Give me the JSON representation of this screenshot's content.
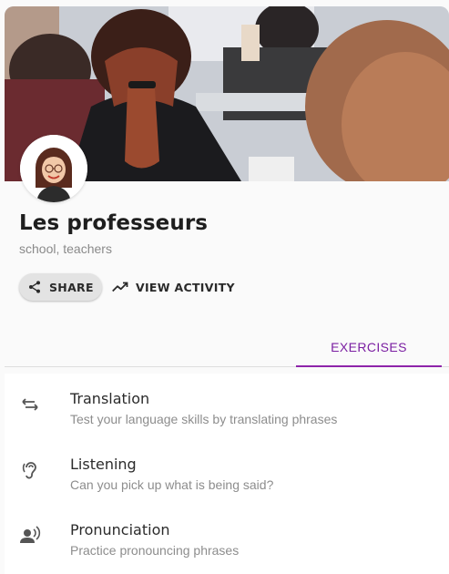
{
  "group": {
    "title": "Les professeurs",
    "tags": "school, teachers"
  },
  "actions": {
    "share_label": "SHARE",
    "activity_label": "VIEW ACTIVITY"
  },
  "tabs": [
    {
      "label": "EXERCISES",
      "active": true
    }
  ],
  "exercises": [
    {
      "name": "Translation",
      "description": "Test your language skills by translating phrases",
      "icon": "swap-arrows-icon"
    },
    {
      "name": "Listening",
      "description": "Can you pick up what is being said?",
      "icon": "hearing-ear-icon"
    },
    {
      "name": "Pronunciation",
      "description": "Practice pronouncing phrases",
      "icon": "person-speaking-icon"
    }
  ],
  "colors": {
    "accent": "#8e24aa",
    "tab_text": "#7b1fa2"
  }
}
